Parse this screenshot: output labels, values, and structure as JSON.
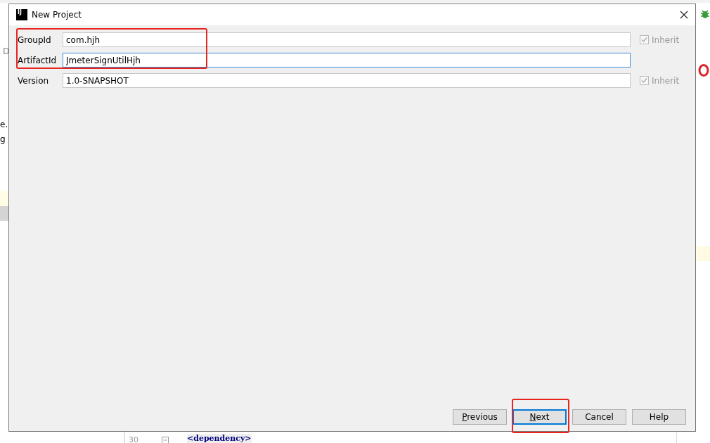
{
  "background_editor": {
    "left_fragments": [
      "D",
      "e.",
      "g"
    ],
    "line_number": "30",
    "code": "<dependency>"
  },
  "window": {
    "app_icon_text": "IJ",
    "title": "New Project"
  },
  "fields": [
    {
      "label": "GroupId",
      "value": "com.hjh",
      "focused": false,
      "highlighted": true,
      "inherit": {
        "label": "Inherit",
        "checked": true
      }
    },
    {
      "label": "ArtifactId",
      "value": "JmeterSignUtilHjh",
      "focused": true,
      "highlighted": true
    },
    {
      "label": "Version",
      "value": "1.0-SNAPSHOT",
      "focused": false,
      "highlighted": false,
      "inherit": {
        "label": "Inherit",
        "checked": true
      }
    }
  ],
  "buttons": [
    {
      "label": "Previous",
      "mnemonic": true,
      "default": false,
      "highlighted": false
    },
    {
      "label": "Next",
      "mnemonic": true,
      "default": true,
      "highlighted": true
    },
    {
      "label": "Cancel",
      "mnemonic": false,
      "default": false,
      "highlighted": false
    },
    {
      "label": "Help",
      "mnemonic": false,
      "default": false,
      "highlighted": false
    }
  ]
}
